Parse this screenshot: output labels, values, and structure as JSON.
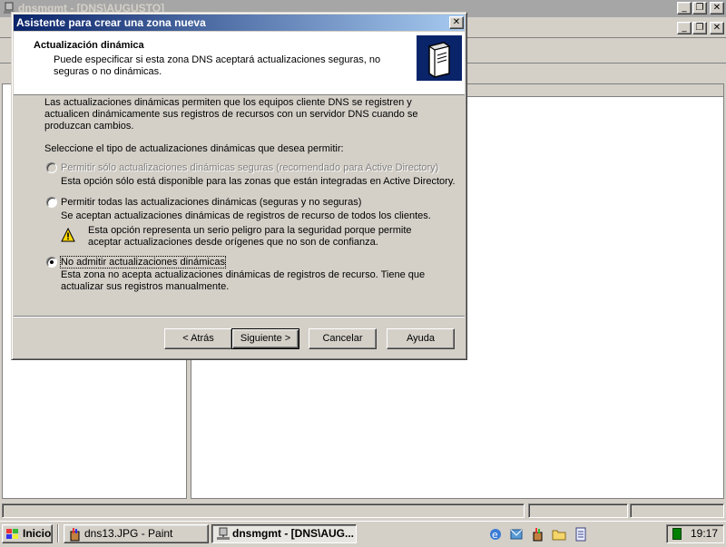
{
  "app": {
    "title": "dnsmgmt - [DNS\\AUGUSTO]"
  },
  "wizard": {
    "title": "Asistente para crear una zona nueva",
    "close_glyph": "✕",
    "header_title": "Actualización dinámica",
    "header_subtitle": "Puede especificar si esta zona DNS aceptará actualizaciones seguras, no seguras o no dinámicas.",
    "intro": "Las actualizaciones dinámicas permiten que los equipos cliente DNS se registren y actualicen dinámicamente sus registros de recursos con un servidor DNS cuando se produzcan cambios.",
    "select_label": "Seleccione el tipo de actualizaciones dinámicas que desea permitir:",
    "options": [
      {
        "label": "Permitir sólo actualizaciones dinámicas seguras (recomendado para Active Directory)",
        "desc": "Esta opción sólo está disponible para las zonas que están integradas en Active Directory.",
        "enabled": false,
        "selected": false
      },
      {
        "label": "Permitir todas las actualizaciones dinámicas (seguras y no seguras)",
        "desc": "Se aceptan actualizaciones dinámicas de registros de recurso de todos los clientes.",
        "warning": "Esta opción representa un serio peligro para la seguridad porque permite aceptar actualizaciones desde orígenes que no son de confianza.",
        "enabled": true,
        "selected": false
      },
      {
        "label": "No admitir actualizaciones dinámicas",
        "desc": "Esta zona no acepta actualizaciones dinámicas de registros de recurso. Tiene que actualizar sus registros manualmente.",
        "enabled": true,
        "selected": true
      }
    ],
    "buttons": {
      "back": "< Atrás",
      "next": "Siguiente >",
      "cancel": "Cancelar",
      "help": "Ayuda"
    }
  },
  "taskbar": {
    "start_label": "Inicio",
    "tasks": [
      {
        "label": "dns13.JPG - Paint",
        "icon": "paint-icon",
        "active": false
      },
      {
        "label": "dnsmgmt - [DNS\\AUG...",
        "icon": "dns-icon",
        "active": true
      }
    ],
    "quicklaunch_icons": [
      "ie-icon",
      "outlook-express-icon",
      "paint-icon",
      "folder-icon",
      "notepad-icon"
    ],
    "clock": "19:17"
  },
  "colors": {
    "title_active_start": "#0a246a",
    "title_active_end": "#a6caf0",
    "title_inactive": "#a6a6a6",
    "face": "#d4d0c8",
    "warning": "#ffd800"
  }
}
